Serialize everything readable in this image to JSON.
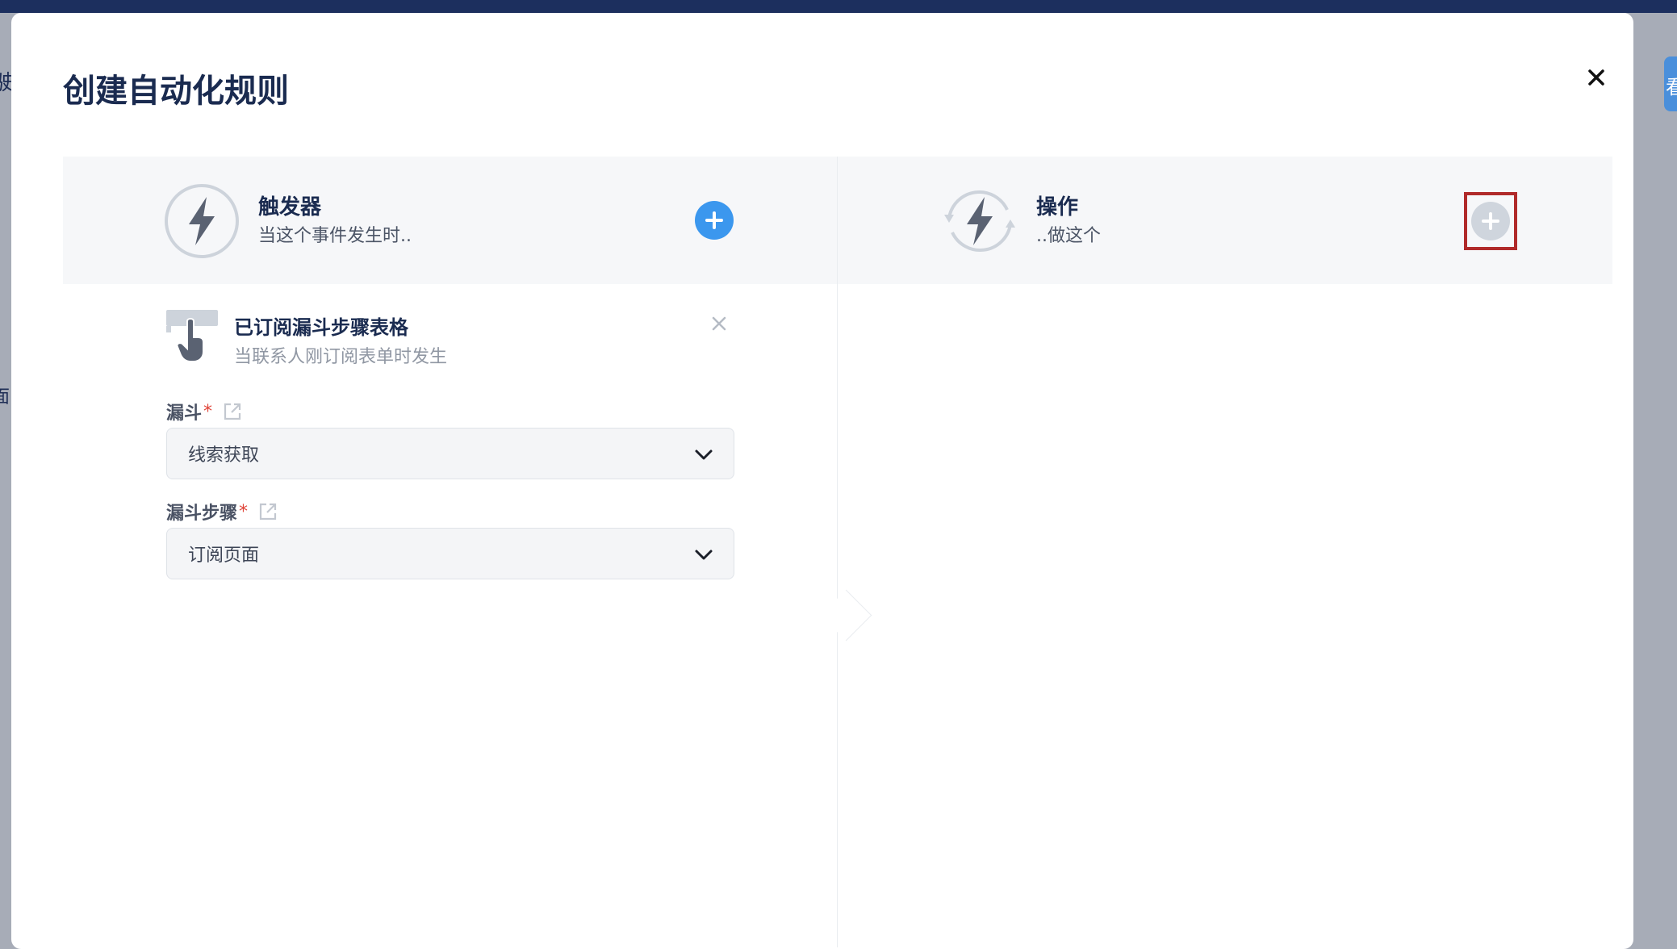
{
  "modal": {
    "title": "创建自动化规则"
  },
  "background": {
    "left_fragments": [
      "驶",
      "面"
    ],
    "right_fragment": "看"
  },
  "trigger_header": {
    "title": "触发器",
    "subtitle": "当这个事件发生时.."
  },
  "action_header": {
    "title": "操作",
    "subtitle": "..做这个"
  },
  "trigger": {
    "name": "已订阅漏斗步骤表格",
    "description": "当联系人刚订阅表单时发生",
    "fields": [
      {
        "label": "漏斗",
        "required_mark": "*",
        "value": "线索获取"
      },
      {
        "label": "漏斗步骤",
        "required_mark": "*",
        "value": "订阅页面"
      }
    ]
  },
  "colors": {
    "accent": "#3b97ee",
    "title": "#1a2b50",
    "required": "#e0453a",
    "highlight_box": "#b02a2a"
  },
  "icons": {
    "close": "close-icon",
    "trigger": "lightning-icon",
    "action": "lightning-cycle-icon",
    "add": "plus-icon",
    "form_trigger": "form-hand-icon",
    "external_link": "external-link-icon",
    "dropdown": "chevron-down-icon"
  }
}
